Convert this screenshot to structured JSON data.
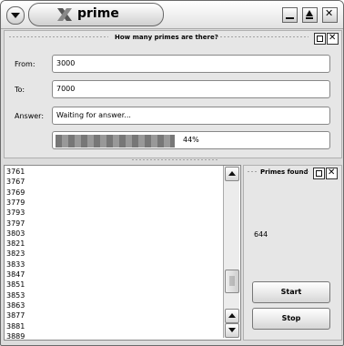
{
  "window": {
    "title": "prime",
    "icons": [
      "menu-chevron-icon",
      "app-x-icon",
      "minimize-icon",
      "maximize-icon",
      "close-icon"
    ]
  },
  "query_panel": {
    "title": "How many primes are there?",
    "from_label": "From:",
    "from_value": "3000",
    "to_label": "To:",
    "to_value": "7000",
    "answer_label": "Answer:",
    "answer_value": "Waiting for answer...",
    "progress_percent": 44,
    "progress_text": "44%"
  },
  "primes_list": {
    "items": [
      "3761",
      "3767",
      "3769",
      "3779",
      "3793",
      "3797",
      "3803",
      "3821",
      "3823",
      "3833",
      "3847",
      "3851",
      "3853",
      "3863",
      "3877",
      "3881",
      "3889"
    ]
  },
  "primes_found_panel": {
    "title": "Primes found",
    "count": "644",
    "start_label": "Start",
    "stop_label": "Stop"
  }
}
